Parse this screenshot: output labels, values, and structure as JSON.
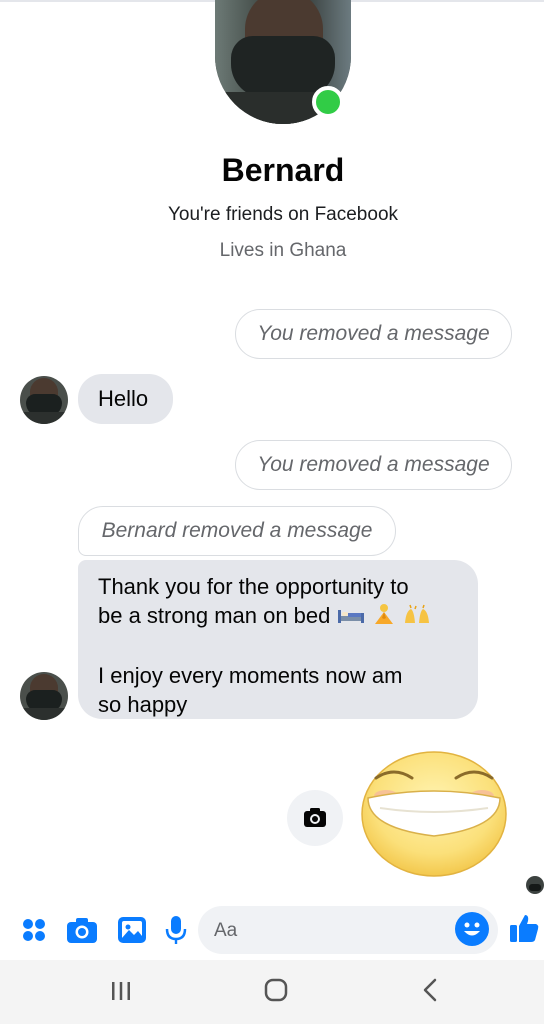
{
  "header": {
    "contact_name": "Bernard",
    "friends_text": "You're friends on Facebook",
    "location_text": "Lives in Ghana",
    "online_status_color": "#31cc46"
  },
  "messages": {
    "removed_1": "You removed a message",
    "hello": "Hello",
    "removed_2": "You removed a message",
    "bernard_removed": "Bernard removed a message",
    "thank_you_line1": "Thank you for the opportunity to",
    "thank_you_line2": "be a strong man on bed",
    "thank_you_emojis": [
      "bed-emoji",
      "praying-person-emoji",
      "raising-hands-emoji"
    ],
    "enjoy_line1": "I enjoy every moments now am",
    "enjoy_line2": "so happy"
  },
  "sticker": {
    "name": "grinning-face-sticker"
  },
  "composer": {
    "placeholder": "Aa",
    "icons": [
      "menu-dots-icon",
      "camera-icon",
      "gallery-icon",
      "microphone-icon",
      "emoji-icon",
      "like-icon"
    ],
    "accent_color": "#0a7cff"
  },
  "system_nav": {
    "buttons": [
      "recent-apps-icon",
      "home-icon",
      "back-icon"
    ]
  }
}
